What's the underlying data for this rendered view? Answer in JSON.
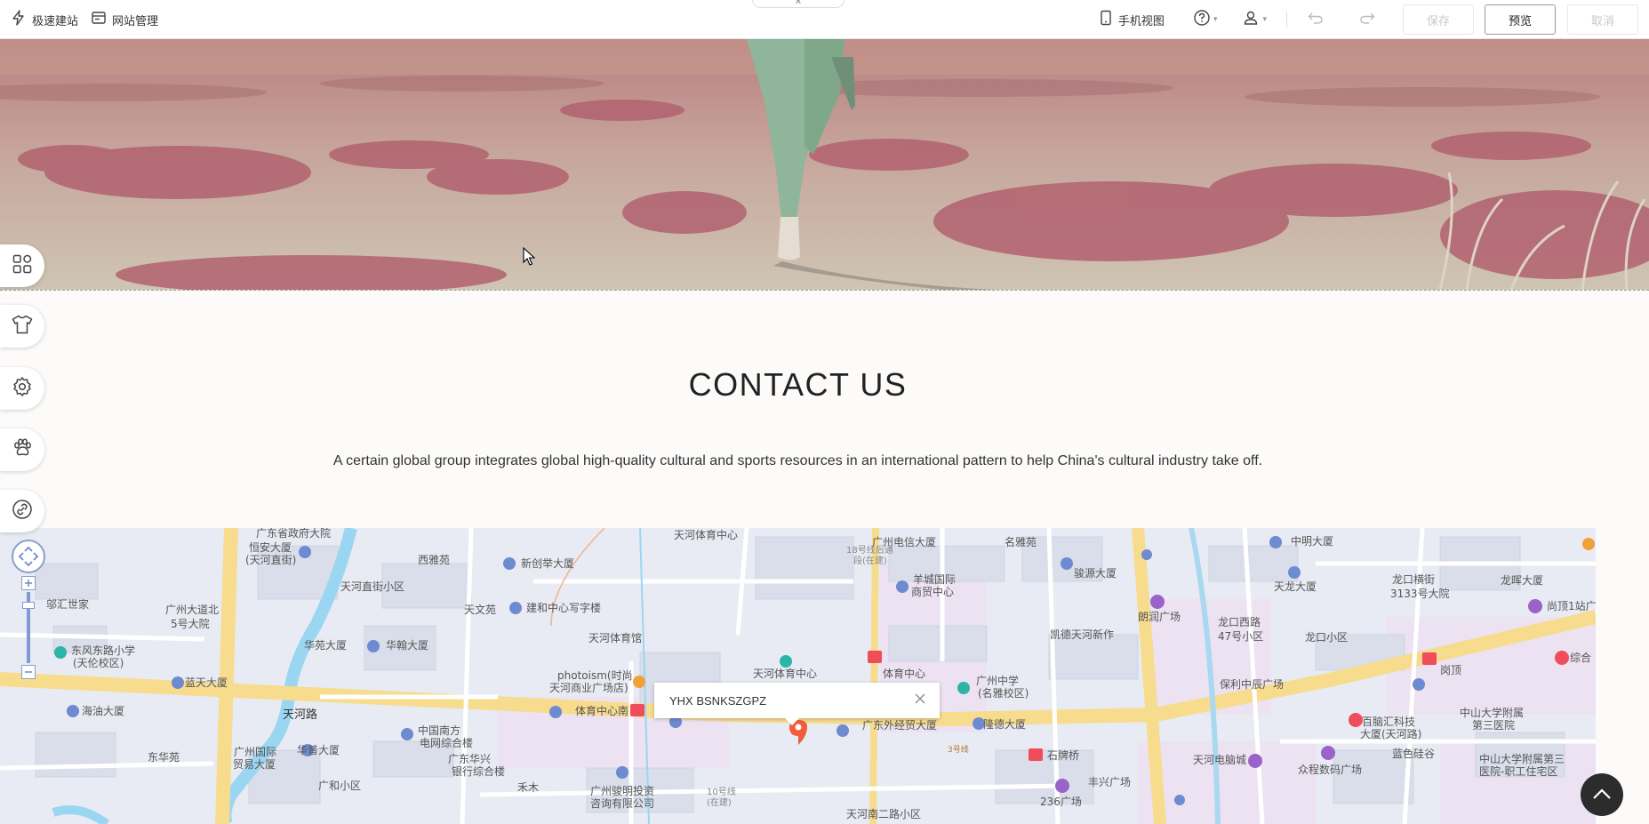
{
  "topbar": {
    "quick_build": "极速建站",
    "site_manage": "网站管理",
    "mobile_view": "手机视图",
    "save": "保存",
    "preview": "预览",
    "cancel": "取消"
  },
  "contact": {
    "title": "CONTACT US",
    "description": "A certain global group integrates global high-quality cultural and sports resources in an international pattern to help China's cultural industry take off."
  },
  "map": {
    "popup_text": "YHX BSNKSZGPZ",
    "labels": [
      "天河体育中心",
      "广州电信大厦",
      "名雅苑",
      "中明大厦",
      "龙口横街",
      "3133号大院",
      "龙晖大厦",
      "广东省政府大院",
      "恒安大厦",
      "(天河直街)",
      "西雅苑",
      "新创举大厦",
      "羊城国际",
      "商贸中心",
      "骏源大厦",
      "天龙大厦",
      "邬汇世家",
      "广州大道北",
      "5号大院",
      "天河直街小区",
      "天文苑",
      "建和中心写字楼",
      "朗润广场",
      "龙口西路",
      "47号小区",
      "凯德天河新作",
      "龙口小区",
      "尚顶1站广场",
      "东风东路小学",
      "(天伦校区)",
      "华苑大厦",
      "华翰大厦",
      "天河体育馆",
      "广州中学",
      "(名雅校区)",
      "保利中辰广场",
      "综合",
      "蓝天大厦",
      "photoism(时尚",
      "天河商业广场店)",
      "天河体育中心",
      "体育中心",
      "岗顶",
      "海油大厦",
      "天河路",
      "体育中心南",
      "广东外经贸大厦",
      "隆德大厦",
      "中山大学附属",
      "第三医院",
      "中国南方",
      "电网综合楼",
      "百脑汇科技",
      "大厦(天河路)",
      "东华苑",
      "广州国际",
      "贸易大厦",
      "华普大厦",
      "广东华兴",
      "银行综合楼",
      "石牌桥",
      "天河电脑城",
      "众程数码广场",
      "蓝色硅谷",
      "中山大学附属第三",
      "医院-职工住宅区",
      "广和小区",
      "禾木",
      "广州骏明投资",
      "咨询有限公司",
      "丰兴广场",
      "236广场",
      "天河南二路小区",
      "10号线",
      "(在建)",
      "18号线后通",
      "段(在建)",
      "3号线"
    ]
  }
}
